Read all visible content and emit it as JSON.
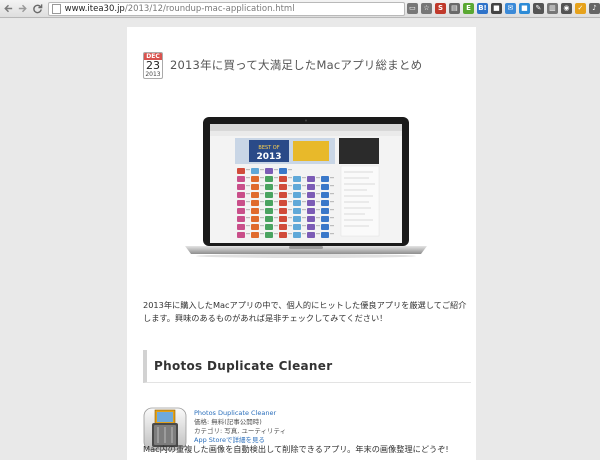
{
  "browser": {
    "url_host": "www.itea30.jp",
    "url_path": "/2013/12/roundup-mac-application.html",
    "extensions": [
      {
        "name": "chrome-tab-icon",
        "label": "▭",
        "color": "#777777"
      },
      {
        "name": "star-icon",
        "label": "☆",
        "color": "#777777"
      },
      {
        "name": "ext-s-icon",
        "label": "S",
        "color": "#c0392b"
      },
      {
        "name": "ext-doc-icon",
        "label": "▤",
        "color": "#6a6a6a"
      },
      {
        "name": "ext-evernote-icon",
        "label": "E",
        "color": "#5aa832"
      },
      {
        "name": "ext-blog-icon",
        "label": "B!",
        "color": "#2f73c9"
      },
      {
        "name": "ext-square-icon",
        "label": "■",
        "color": "#444444"
      },
      {
        "name": "ext-mail-icon",
        "label": "✉",
        "color": "#3b8ad8"
      },
      {
        "name": "ext-chat-icon",
        "label": "■",
        "color": "#2d8bd6"
      },
      {
        "name": "wrench-icon",
        "label": "✎",
        "color": "#555555"
      },
      {
        "name": "ext-note-icon",
        "label": "▥",
        "color": "#777777"
      },
      {
        "name": "ext-round-icon",
        "label": "◉",
        "color": "#555555"
      },
      {
        "name": "ext-check-icon",
        "label": "✓",
        "color": "#e6a21c"
      },
      {
        "name": "ext-profile-icon",
        "label": "♪",
        "color": "#666666"
      }
    ]
  },
  "post": {
    "date": {
      "month": "DEC",
      "day": "23",
      "year": "2013"
    },
    "title": "2013年に買って大満足したMacアプリ総まとめ",
    "hero_badge_line1": "BEST OF",
    "hero_badge_line2": "2013",
    "intro": "2013年に購入したMacアプリの中で、個人的にヒットした優良アプリを厳選してご紹介します。興味のあるものがあれば是非チェックしてみてください！",
    "section": {
      "heading": "Photos Duplicate Cleaner",
      "app_name": "Photos Duplicate Cleaner",
      "price": "価格: 無料(記事公開時)",
      "category": "カテゴリ: 写真, ユーティリティ",
      "store_link": "App Storeで詳細を見る",
      "description": "Mac内の重複した画像を自動検出して削除できるアプリ。年末の画像整理にどうぞ!"
    }
  }
}
